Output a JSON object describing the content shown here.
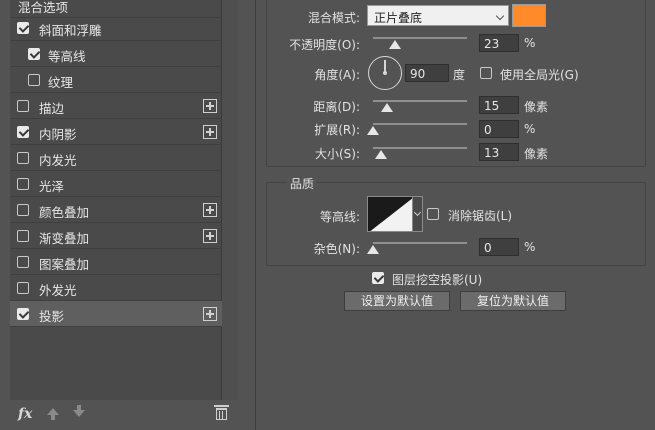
{
  "layer_style_list": {
    "header_label": "混合选项",
    "items": [
      {
        "label": "斜面和浮雕",
        "checked": true,
        "has_add": false
      },
      {
        "label": "等高线",
        "checked": true,
        "has_add": false
      },
      {
        "label": "纹理",
        "checked": false,
        "has_add": false
      },
      {
        "label": "描边",
        "checked": false,
        "has_add": true
      },
      {
        "label": "内阴影",
        "checked": true,
        "has_add": true
      },
      {
        "label": "内发光",
        "checked": false,
        "has_add": false
      },
      {
        "label": "光泽",
        "checked": false,
        "has_add": false
      },
      {
        "label": "颜色叠加",
        "checked": false,
        "has_add": true
      },
      {
        "label": "渐变叠加",
        "checked": false,
        "has_add": true
      },
      {
        "label": "图案叠加",
        "checked": false,
        "has_add": false
      },
      {
        "label": "外发光",
        "checked": false,
        "has_add": false
      },
      {
        "label": "投影",
        "checked": true,
        "has_add": true,
        "selected": true
      }
    ],
    "toolbar": {
      "fx_label": "fx"
    }
  },
  "structure": {
    "blend_mode_label": "混合模式:",
    "blend_mode_value": "正片叠底",
    "shadow_color": "#ff8a2a",
    "opacity_label": "不透明度(O):",
    "opacity_value": "23",
    "opacity_unit": "%",
    "angle_label": "角度(A):",
    "angle_value": "90",
    "angle_unit": "度",
    "global_light_label": "使用全局光(G)",
    "global_light_checked": false,
    "distance_label": "距离(D):",
    "distance_value": "15",
    "distance_unit": "像素",
    "spread_label": "扩展(R):",
    "spread_value": "0",
    "spread_unit": "%",
    "size_label": "大小(S):",
    "size_value": "13",
    "size_unit": "像素"
  },
  "quality": {
    "section_title": "品质",
    "contour_label": "等高线:",
    "anti_alias_label": "消除锯齿(L)",
    "anti_alias_checked": false,
    "noise_label": "杂色(N):",
    "noise_value": "0",
    "noise_unit": "%"
  },
  "footer": {
    "knockout_label": "图层挖空投影(U)",
    "knockout_checked": true,
    "make_default_label": "设置为默认值",
    "reset_default_label": "复位为默认值"
  }
}
